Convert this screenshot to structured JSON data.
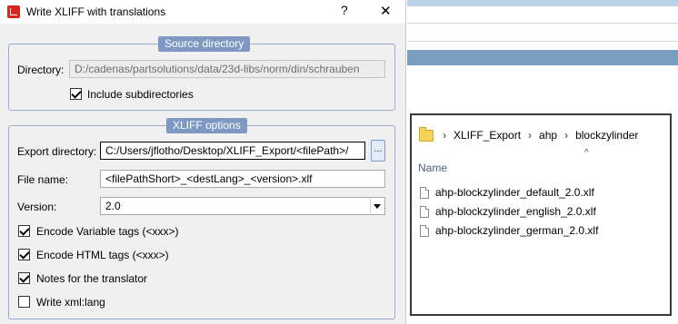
{
  "dialog": {
    "title": "Write XLIFF with translations",
    "help_glyph": "?",
    "close_glyph": "✕",
    "source_group": {
      "legend": "Source directory",
      "directory_label": "Directory:",
      "directory_value": "D:/cadenas/partsolutions/data/23d-libs/norm/din/schrauben",
      "include_subdirs_label": "Include subdirectories",
      "include_subdirs_checked": true
    },
    "xliff_group": {
      "legend": "XLIFF options",
      "export_dir_label": "Export directory:",
      "export_dir_value": "C:/Users/jflotho/Desktop/XLIFF_Export/<filePath>/",
      "browse_label": "...",
      "file_name_label": "File name:",
      "file_name_value": "<filePathShort>_<destLang>_<version>.xlf",
      "version_label": "Version:",
      "version_value": "2.0",
      "options": [
        {
          "label": "Encode Variable tags (<xxx>)",
          "checked": true
        },
        {
          "label": "Encode HTML tags (<xxx>)",
          "checked": true
        },
        {
          "label": "Notes for the translator",
          "checked": true
        },
        {
          "label": "Write xml:lang",
          "checked": false
        }
      ]
    }
  },
  "explorer": {
    "breadcrumb": [
      "XLIFF_Export",
      "ahp",
      "blockzylinder"
    ],
    "breadcrumb_sep": "›",
    "sort_caret": "^",
    "column_name": "Name",
    "files": [
      {
        "name": "ahp-blockzylinder_default_2.0.xlf",
        "icon": "document-icon"
      },
      {
        "name": "ahp-blockzylinder_english_2.0.xlf",
        "icon": "document-icon"
      },
      {
        "name": "ahp-blockzylinder_german_2.0.xlf",
        "icon": "document-icon"
      }
    ]
  }
}
